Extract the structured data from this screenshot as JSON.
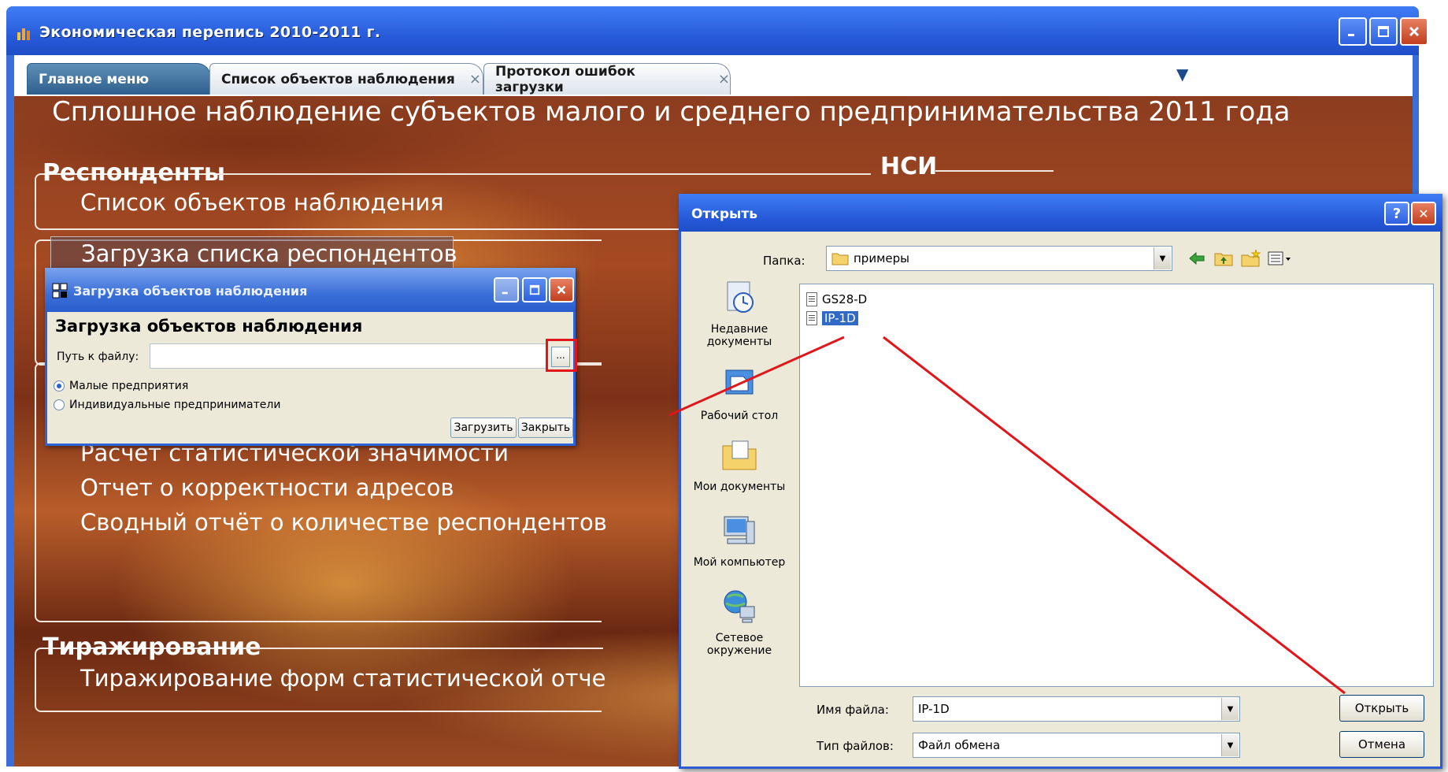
{
  "app": {
    "title": "Экономическая перепись 2010-2011 г.",
    "tabs": [
      {
        "label": "Главное меню",
        "active": true,
        "closable": false
      },
      {
        "label": "Список объектов наблюдения",
        "active": false,
        "closable": true
      },
      {
        "label": "Протокол ошибок загрузки",
        "active": false,
        "closable": true
      }
    ],
    "tab_close_glyph": "×",
    "tabs_menu_glyph": "▼"
  },
  "main": {
    "heading": "Сплошное наблюдение субъектов малого и среднего предпринимательства 2011 года",
    "groups": {
      "respondents": {
        "title": "Респонденты",
        "items": [
          "Список объектов наблюдения"
        ]
      },
      "load": {
        "items": [
          "Загрузка списка респондентов"
        ]
      },
      "reports": {
        "items": [
          "Расчет статистической значимости",
          "Отчет о корректности адресов",
          "Сводный отчёт о количестве респондентов"
        ]
      },
      "replication": {
        "title": "Тиражирование",
        "items": [
          "Тиражирование форм статистической отче"
        ]
      },
      "nsi": {
        "title": "НСИ"
      }
    }
  },
  "load_dialog": {
    "title": "Загрузка объектов наблюдения",
    "heading": "Загрузка объектов наблюдения",
    "path_label": "Путь к файлу:",
    "path_value": "",
    "browse_label": "...",
    "radios": [
      {
        "label": "Малые предприятия",
        "checked": true
      },
      {
        "label": "Индивидуальные предприниматели",
        "checked": false
      }
    ],
    "load_button": "Загрузить",
    "close_button": "Закрыть"
  },
  "open_dialog": {
    "title": "Открыть",
    "folder_label": "Папка:",
    "folder_value": "примеры",
    "places": [
      "Недавние документы",
      "Рабочий стол",
      "Мои документы",
      "Мой компьютер",
      "Сетевое окружение"
    ],
    "files": [
      {
        "name": "GS28-D",
        "selected": false
      },
      {
        "name": "IP-1D",
        "selected": true
      }
    ],
    "filename_label": "Имя файла:",
    "filename_value": "IP-1D",
    "filetype_label": "Тип файлов:",
    "filetype_value": "Файл обмена",
    "open_button": "Открыть",
    "cancel_button": "Отмена",
    "help_glyph": "?",
    "close_glyph": "✕"
  },
  "colors": {
    "xp_titlebar": "#2557d6",
    "annotation_red": "#e0161b",
    "selection_blue": "#316ac5"
  }
}
